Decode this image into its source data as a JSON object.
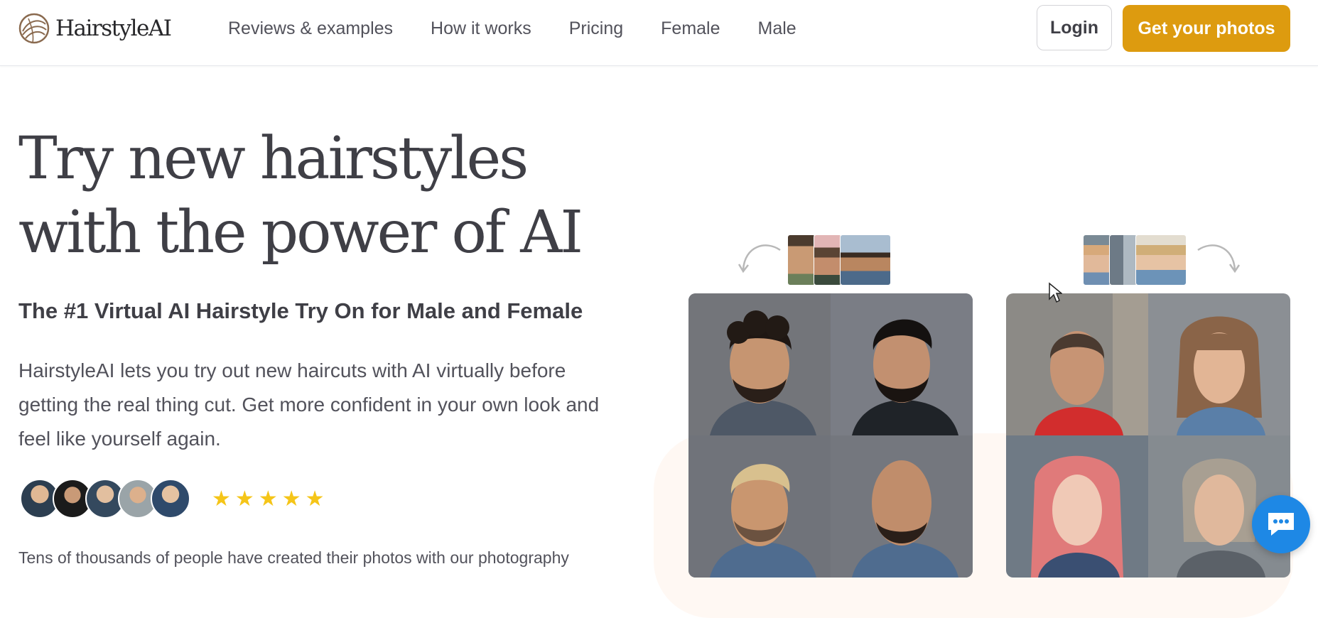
{
  "header": {
    "logo_text": "HairstyleAI",
    "nav": [
      {
        "label": "Reviews & examples"
      },
      {
        "label": "How it works"
      },
      {
        "label": "Pricing"
      },
      {
        "label": "Female"
      },
      {
        "label": "Male"
      }
    ],
    "login_label": "Login",
    "cta_label": "Get your photos"
  },
  "hero": {
    "title_line1": "Try new hairstyles",
    "title_line2": "with the power of AI",
    "subtitle": "The #1 Virtual AI Hairstyle Try On for Male and Female",
    "description": "HairstyleAI lets you try out new haircuts with AI virtually before getting the real thing cut. Get more confident in your own look and feel like yourself again.",
    "rating_stars": 5,
    "footnote": "Tens of thousands of people have created their photos with our photography"
  },
  "colors": {
    "accent": "#dd9b0f",
    "star": "#f5c518",
    "chat": "#1e88e5",
    "text": "#3f3f46"
  },
  "icons": {
    "logo": "hairstyle-logo-icon",
    "star": "star-icon",
    "chat": "chat-bubble-icon",
    "arrow": "curved-arrow-icon"
  }
}
